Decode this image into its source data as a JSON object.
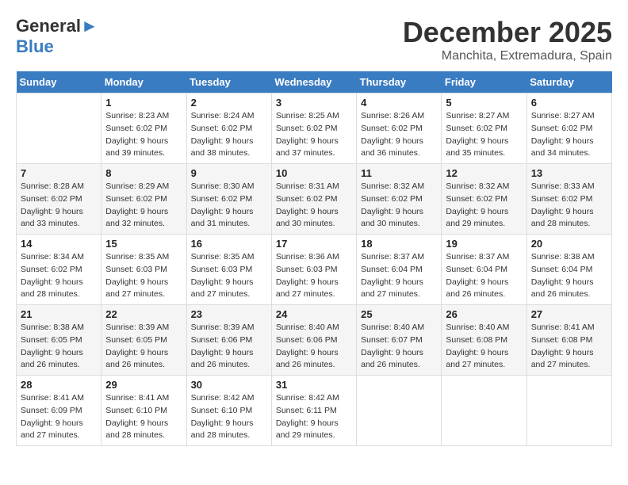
{
  "logo": {
    "general": "General",
    "blue": "Blue",
    "arrow_unicode": "▶"
  },
  "header": {
    "month": "December 2025",
    "location": "Manchita, Extremadura, Spain"
  },
  "calendar": {
    "days_of_week": [
      "Sunday",
      "Monday",
      "Tuesday",
      "Wednesday",
      "Thursday",
      "Friday",
      "Saturday"
    ],
    "weeks": [
      [
        {
          "day": "",
          "info": ""
        },
        {
          "day": "1",
          "info": "Sunrise: 8:23 AM\nSunset: 6:02 PM\nDaylight: 9 hours\nand 39 minutes."
        },
        {
          "day": "2",
          "info": "Sunrise: 8:24 AM\nSunset: 6:02 PM\nDaylight: 9 hours\nand 38 minutes."
        },
        {
          "day": "3",
          "info": "Sunrise: 8:25 AM\nSunset: 6:02 PM\nDaylight: 9 hours\nand 37 minutes."
        },
        {
          "day": "4",
          "info": "Sunrise: 8:26 AM\nSunset: 6:02 PM\nDaylight: 9 hours\nand 36 minutes."
        },
        {
          "day": "5",
          "info": "Sunrise: 8:27 AM\nSunset: 6:02 PM\nDaylight: 9 hours\nand 35 minutes."
        },
        {
          "day": "6",
          "info": "Sunrise: 8:27 AM\nSunset: 6:02 PM\nDaylight: 9 hours\nand 34 minutes."
        }
      ],
      [
        {
          "day": "7",
          "info": "Sunrise: 8:28 AM\nSunset: 6:02 PM\nDaylight: 9 hours\nand 33 minutes."
        },
        {
          "day": "8",
          "info": "Sunrise: 8:29 AM\nSunset: 6:02 PM\nDaylight: 9 hours\nand 32 minutes."
        },
        {
          "day": "9",
          "info": "Sunrise: 8:30 AM\nSunset: 6:02 PM\nDaylight: 9 hours\nand 31 minutes."
        },
        {
          "day": "10",
          "info": "Sunrise: 8:31 AM\nSunset: 6:02 PM\nDaylight: 9 hours\nand 30 minutes."
        },
        {
          "day": "11",
          "info": "Sunrise: 8:32 AM\nSunset: 6:02 PM\nDaylight: 9 hours\nand 30 minutes."
        },
        {
          "day": "12",
          "info": "Sunrise: 8:32 AM\nSunset: 6:02 PM\nDaylight: 9 hours\nand 29 minutes."
        },
        {
          "day": "13",
          "info": "Sunrise: 8:33 AM\nSunset: 6:02 PM\nDaylight: 9 hours\nand 28 minutes."
        }
      ],
      [
        {
          "day": "14",
          "info": "Sunrise: 8:34 AM\nSunset: 6:02 PM\nDaylight: 9 hours\nand 28 minutes."
        },
        {
          "day": "15",
          "info": "Sunrise: 8:35 AM\nSunset: 6:03 PM\nDaylight: 9 hours\nand 27 minutes."
        },
        {
          "day": "16",
          "info": "Sunrise: 8:35 AM\nSunset: 6:03 PM\nDaylight: 9 hours\nand 27 minutes."
        },
        {
          "day": "17",
          "info": "Sunrise: 8:36 AM\nSunset: 6:03 PM\nDaylight: 9 hours\nand 27 minutes."
        },
        {
          "day": "18",
          "info": "Sunrise: 8:37 AM\nSunset: 6:04 PM\nDaylight: 9 hours\nand 27 minutes."
        },
        {
          "day": "19",
          "info": "Sunrise: 8:37 AM\nSunset: 6:04 PM\nDaylight: 9 hours\nand 26 minutes."
        },
        {
          "day": "20",
          "info": "Sunrise: 8:38 AM\nSunset: 6:04 PM\nDaylight: 9 hours\nand 26 minutes."
        }
      ],
      [
        {
          "day": "21",
          "info": "Sunrise: 8:38 AM\nSunset: 6:05 PM\nDaylight: 9 hours\nand 26 minutes."
        },
        {
          "day": "22",
          "info": "Sunrise: 8:39 AM\nSunset: 6:05 PM\nDaylight: 9 hours\nand 26 minutes."
        },
        {
          "day": "23",
          "info": "Sunrise: 8:39 AM\nSunset: 6:06 PM\nDaylight: 9 hours\nand 26 minutes."
        },
        {
          "day": "24",
          "info": "Sunrise: 8:40 AM\nSunset: 6:06 PM\nDaylight: 9 hours\nand 26 minutes."
        },
        {
          "day": "25",
          "info": "Sunrise: 8:40 AM\nSunset: 6:07 PM\nDaylight: 9 hours\nand 26 minutes."
        },
        {
          "day": "26",
          "info": "Sunrise: 8:40 AM\nSunset: 6:08 PM\nDaylight: 9 hours\nand 27 minutes."
        },
        {
          "day": "27",
          "info": "Sunrise: 8:41 AM\nSunset: 6:08 PM\nDaylight: 9 hours\nand 27 minutes."
        }
      ],
      [
        {
          "day": "28",
          "info": "Sunrise: 8:41 AM\nSunset: 6:09 PM\nDaylight: 9 hours\nand 27 minutes."
        },
        {
          "day": "29",
          "info": "Sunrise: 8:41 AM\nSunset: 6:10 PM\nDaylight: 9 hours\nand 28 minutes."
        },
        {
          "day": "30",
          "info": "Sunrise: 8:42 AM\nSunset: 6:10 PM\nDaylight: 9 hours\nand 28 minutes."
        },
        {
          "day": "31",
          "info": "Sunrise: 8:42 AM\nSunset: 6:11 PM\nDaylight: 9 hours\nand 29 minutes."
        },
        {
          "day": "",
          "info": ""
        },
        {
          "day": "",
          "info": ""
        },
        {
          "day": "",
          "info": ""
        }
      ]
    ]
  }
}
